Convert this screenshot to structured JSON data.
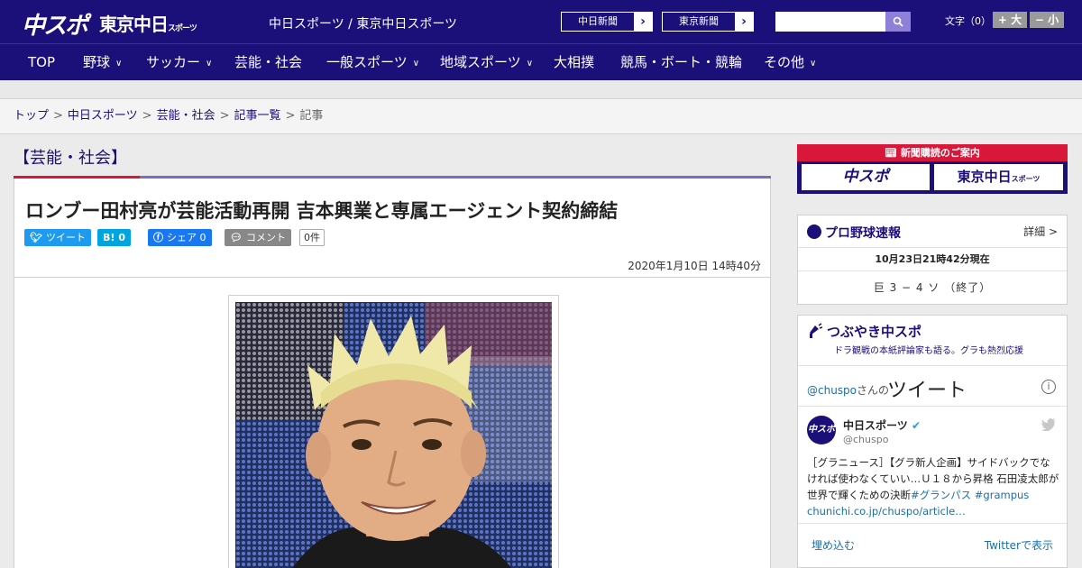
{
  "header": {
    "logo_main": "中スポ",
    "logo_tokyo": "東京中日",
    "logo_tokyo_small": "スポーツ",
    "site_name": "中日スポーツ / 東京中日スポーツ",
    "ext_links": [
      "中日新聞",
      "東京新聞"
    ],
    "search_placeholder": "",
    "fontsize_label": "文字（0）",
    "fontsize_up": "+ 大",
    "fontsize_down": "− 小",
    "brand_color": "#1b0f7a"
  },
  "nav": {
    "items": [
      {
        "label": "TOP"
      },
      {
        "label": "野球"
      },
      {
        "label": "サッカー"
      },
      {
        "label": "芸能・社会"
      },
      {
        "label": "一般スポーツ"
      },
      {
        "label": "地域スポーツ"
      },
      {
        "label": "大相撲"
      },
      {
        "label": "競馬・ボート・競輪"
      },
      {
        "label": "その他"
      }
    ]
  },
  "breadcrumb": {
    "items": [
      "トップ",
      "中日スポーツ",
      "芸能・社会",
      "記事一覧"
    ],
    "current": "記事",
    "separator": ">"
  },
  "article": {
    "category": "【芸能・社会】",
    "title": "ロンブー田村亮が芸能活動再開 吉本興業と専属エージェント契約締結",
    "share": {
      "tweet": "ツイート",
      "hatena_icon": "B!",
      "hatena_count": "0",
      "facebook": "シェア",
      "facebook_count": "0",
      "comment": "コメント",
      "comment_count": "0件"
    },
    "date": "2020年1月10日 14時40分"
  },
  "sidebar": {
    "subscription": {
      "title": "新聞購読のご案内",
      "logo_a": "中スポ",
      "logo_b": "東京中日",
      "logo_b_small": "スポーツ"
    },
    "baseball": {
      "title": "プロ野球速報",
      "more": "詳細 >",
      "time": "10月23日21時42分現在",
      "score": "巨 3 − 4 ソ （終了）"
    },
    "tweets": {
      "title": "つぶやき中スポ",
      "subtitle": "ドラ観戦の本紙評論家も語る。グラも熱烈応援",
      "user_link": "@chuspo",
      "user_suffix": "さんの",
      "big_label": "ツイート",
      "name": "中日スポーツ",
      "handle": "@chuspo",
      "avatar": "中スポ",
      "text": "［グラニュース］【グラ新人企画】サイドバックでなければ使わなくていい…Ｕ１８から昇格 石田凌太郎が世界で輝くための決断",
      "hashtags": "#グランパス #grampus",
      "link": "chunichi.co.jp/chuspo/article…",
      "embed": "埋め込む",
      "view_on": "Twitterで表示"
    }
  }
}
